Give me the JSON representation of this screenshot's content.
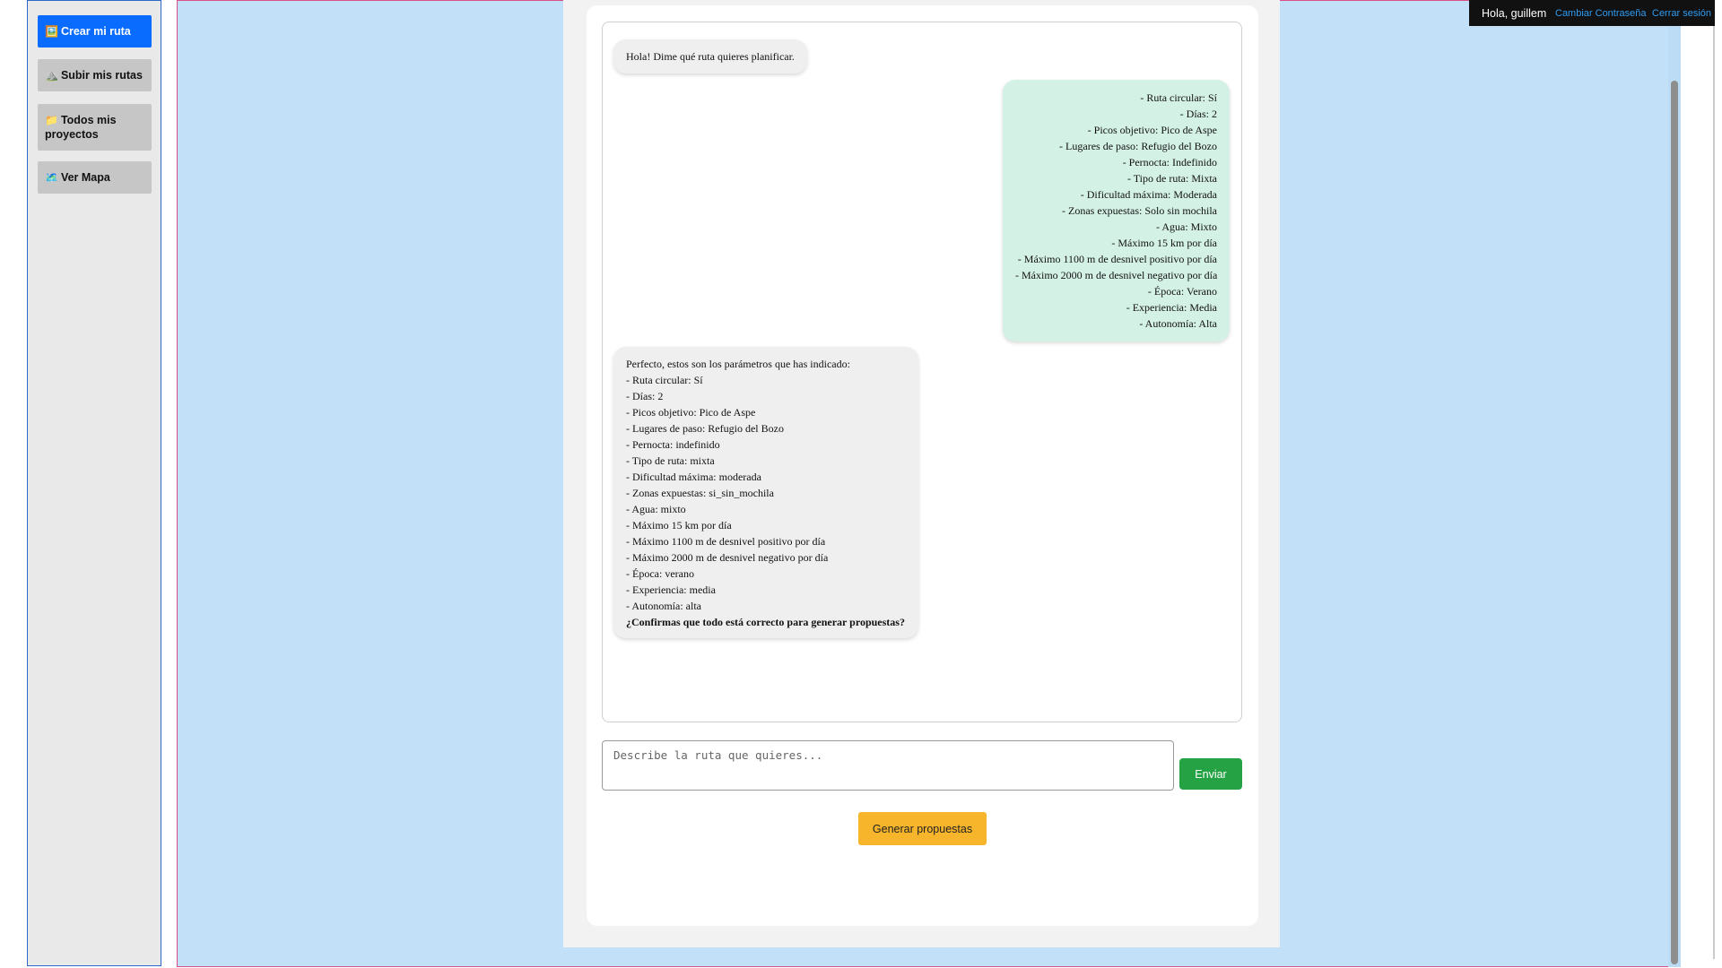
{
  "sidebar": {
    "items": [
      {
        "icon": "🖼️",
        "label": "Crear mi ruta",
        "active": true
      },
      {
        "icon": "⛰️",
        "label": "Subir mis rutas"
      },
      {
        "icon": "📁",
        "label": "Todos mis proyectos"
      },
      {
        "icon": "🗺️",
        "label": "Ver Mapa"
      }
    ]
  },
  "topbar": {
    "greeting": "Hola, guillem",
    "change_password": "Cambiar Contraseña",
    "logout": "Cerrar sesión"
  },
  "chat": {
    "messages": [
      {
        "role": "bot",
        "lines": [
          "Hola! Dime qué ruta quieres planificar."
        ]
      },
      {
        "role": "user",
        "lines": [
          "- Ruta circular: Sí",
          "- Días: 2",
          "- Picos objetivo: Pico de Aspe",
          "- Lugares de paso: Refugio del Bozo",
          "- Pernocta: Indefinido",
          "- Tipo de ruta: Mixta",
          "- Dificultad máxima: Moderada",
          "- Zonas expuestas: Solo sin mochila",
          "- Agua: Mixto",
          "- Máximo 15 km por día",
          "- Máximo 1100 m de desnivel positivo por día",
          "- Máximo 2000 m de desnivel negativo por día",
          "- Época: Verano",
          "- Experiencia: Media",
          "- Autonomía: Alta"
        ]
      },
      {
        "role": "bot",
        "lines": [
          "Perfecto, estos son los parámetros que has indicado:",
          "- Ruta circular: Sí",
          "- Días: 2",
          "- Picos objetivo: Pico de Aspe",
          "- Lugares de paso: Refugio del Bozo",
          "- Pernocta: indefinido",
          "- Tipo de ruta: mixta",
          "- Dificultad máxima: moderada",
          "- Zonas expuestas: si_sin_mochila",
          "- Agua: mixto",
          "- Máximo 15 km por día",
          "- Máximo 1100 m de desnivel positivo por día",
          "- Máximo 2000 m de desnivel negativo por día",
          "- Época: verano",
          "- Experiencia: media",
          "- Autonomía: alta"
        ],
        "question": "¿Confirmas que todo está correcto para generar propuestas?"
      }
    ],
    "input_placeholder": "Describe la ruta que quieres...",
    "input_value": "",
    "send_label": "Enviar",
    "generate_label": "Generar propuestas"
  },
  "colors": {
    "main_bg": "#c2e1f9",
    "active_button": "#0a6cff",
    "send_button": "#25a244",
    "generate_button": "#f6b52a",
    "user_bubble": "#d4f1e6",
    "bot_bubble": "#efefef"
  }
}
